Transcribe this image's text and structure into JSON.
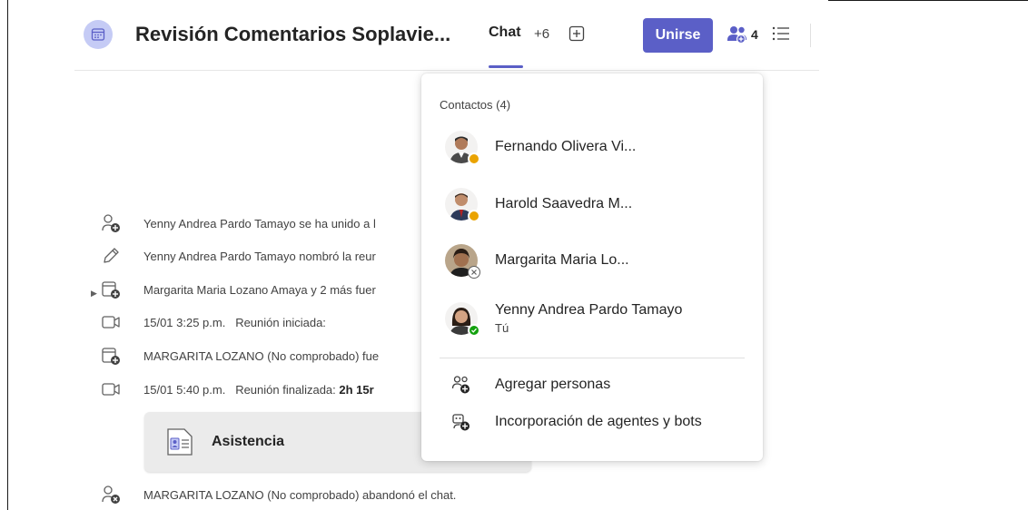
{
  "header": {
    "title": "Revisión Comentarios Soplavie...",
    "tab_chat": "Chat",
    "tab_more": "+6",
    "join_label": "Unirse",
    "participant_count": "4"
  },
  "feed": [
    {
      "icon": "person-add-icon",
      "text": "Yenny Andrea Pardo Tamayo se ha unido a l"
    },
    {
      "icon": "pencil-icon",
      "text": "Yenny Andrea Pardo Tamayo nombró la reur"
    },
    {
      "icon": "calendar-add-icon",
      "text": "Margarita Maria Lozano Amaya y 2 más fuer"
    },
    {
      "icon": "video-icon",
      "time": "15/01 3:25 p.m.",
      "text": "Reunión iniciada:"
    },
    {
      "icon": "calendar-add-icon",
      "text": "MARGARITA LOZANO (No comprobado) fue"
    },
    {
      "icon": "video-icon",
      "time": "15/01 5:40 p.m.",
      "text": "Reunión finalizada:",
      "bold": "2h 15r"
    },
    {
      "icon": "person-leave-icon",
      "text": "MARGARITA LOZANO (No comprobado) abandonó el chat."
    }
  ],
  "attendance": {
    "label": "Asistencia"
  },
  "popup": {
    "heading": "Contactos (4)",
    "contacts": [
      {
        "name": "Fernando Olivera Vi...",
        "presence": "away",
        "presence_color": "#eaa300"
      },
      {
        "name": "Harold Saavedra M...",
        "presence": "away",
        "presence_color": "#eaa300"
      },
      {
        "name": "Margarita Maria Lo...",
        "presence": "offline",
        "presence_color": "#8a8886"
      },
      {
        "name": "Yenny Andrea Pardo Tamayo",
        "sub": "Tú",
        "presence": "available",
        "presence_color": "#13a10e"
      }
    ],
    "actions": [
      {
        "label": "Agregar personas",
        "icon": "person-add-icon"
      },
      {
        "label": "Incorporación de agentes y bots",
        "icon": "bot-add-icon"
      }
    ]
  },
  "colors": {
    "accent": "#5b5fc7",
    "away": "#eaa300",
    "available": "#13a10e"
  }
}
